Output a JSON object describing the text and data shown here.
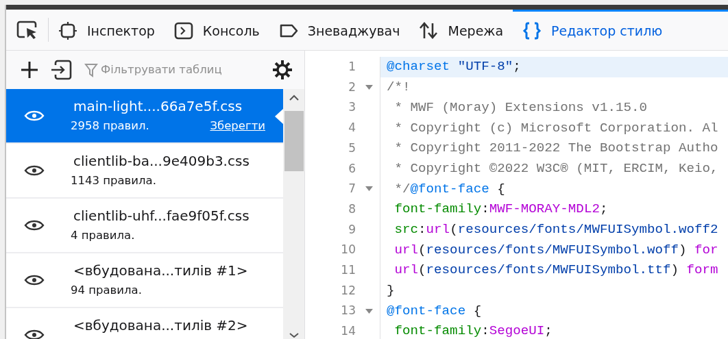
{
  "toolbar": {
    "tabs": [
      {
        "label": "Інспектор",
        "kind": "inspector",
        "selected": false
      },
      {
        "label": "Консоль",
        "kind": "console",
        "selected": false
      },
      {
        "label": "Зневаджувач",
        "kind": "debugger",
        "selected": false
      },
      {
        "label": "Мережа",
        "kind": "network",
        "selected": false
      },
      {
        "label": "Редактор стилю",
        "kind": "style-editor",
        "selected": true
      }
    ]
  },
  "sidebar": {
    "filter": {
      "placeholder": "Фільтрувати таблиц"
    },
    "items": [
      {
        "name": "main-light....66a7e5f.css",
        "rules": "2958 правил.",
        "save_link": "Зберегти",
        "selected": true
      },
      {
        "name": "clientlib-ba...9e409b3.css",
        "rules": "1143 правила.",
        "selected": false
      },
      {
        "name": "clientlib-uhf...fae9f05f.css",
        "rules": "4 правила.",
        "selected": false
      },
      {
        "name": "<вбудована...тилів #1>",
        "rules": "94 правила.",
        "selected": false
      },
      {
        "name": "<вбудована...тилів #2>",
        "selected": false
      }
    ]
  },
  "editor": {
    "lines": [
      {
        "number": "1",
        "foldable": false,
        "highlighted": true,
        "tokens": [
          {
            "kind": "atrule",
            "text": "@charset"
          },
          {
            "kind": "string",
            "text": " \"UTF-8\""
          },
          {
            "kind": "plain",
            "text": ";"
          }
        ]
      },
      {
        "number": "2",
        "foldable": true,
        "highlighted": false,
        "tokens": [
          {
            "kind": "comment",
            "text": "/*!"
          }
        ]
      },
      {
        "number": "3",
        "foldable": false,
        "highlighted": false,
        "tokens": [
          {
            "kind": "comment",
            "text": " * MWF (Moray) Extensions v1.15.0"
          }
        ]
      },
      {
        "number": "4",
        "foldable": false,
        "highlighted": false,
        "tokens": [
          {
            "kind": "comment",
            "text": " * Copyright (c) Microsoft Corporation. Al"
          }
        ]
      },
      {
        "number": "5",
        "foldable": false,
        "highlighted": false,
        "tokens": [
          {
            "kind": "comment",
            "text": " * Copyright 2011-2022 The Bootstrap Autho"
          }
        ]
      },
      {
        "number": "6",
        "foldable": false,
        "highlighted": false,
        "tokens": [
          {
            "kind": "comment",
            "text": " * Copyright ©2022 W3C® (MIT, ERCIM, Keio,"
          }
        ]
      },
      {
        "number": "7",
        "foldable": true,
        "highlighted": false,
        "tokens": [
          {
            "kind": "comment",
            "text": " */"
          },
          {
            "kind": "atrule",
            "text": "@font-face"
          },
          {
            "kind": "plain",
            "text": " {"
          }
        ]
      },
      {
        "number": "8",
        "foldable": false,
        "highlighted": false,
        "tokens": [
          {
            "kind": "property",
            "text": " font-family"
          },
          {
            "kind": "plain",
            "text": ":"
          },
          {
            "kind": "value",
            "text": "MWF-MORAY-MDL2"
          },
          {
            "kind": "plain",
            "text": ";"
          }
        ]
      },
      {
        "number": "9",
        "foldable": false,
        "highlighted": false,
        "tokens": [
          {
            "kind": "property",
            "text": " src"
          },
          {
            "kind": "plain",
            "text": ":"
          },
          {
            "kind": "value",
            "text": "url"
          },
          {
            "kind": "plain",
            "text": "("
          },
          {
            "kind": "string",
            "text": "resources/fonts/MWFUISymbol.woff2"
          }
        ]
      },
      {
        "number": "10",
        "foldable": false,
        "highlighted": false,
        "tokens": [
          {
            "kind": "value",
            "text": " url"
          },
          {
            "kind": "plain",
            "text": "("
          },
          {
            "kind": "string",
            "text": "resources/fonts/MWFUISymbol.woff"
          },
          {
            "kind": "plain",
            "text": ") "
          },
          {
            "kind": "value",
            "text": "for"
          }
        ]
      },
      {
        "number": "11",
        "foldable": false,
        "highlighted": false,
        "tokens": [
          {
            "kind": "value",
            "text": " url"
          },
          {
            "kind": "plain",
            "text": "("
          },
          {
            "kind": "string",
            "text": "resources/fonts/MWFUISymbol.ttf"
          },
          {
            "kind": "plain",
            "text": ") "
          },
          {
            "kind": "value",
            "text": "form"
          }
        ]
      },
      {
        "number": "12",
        "foldable": false,
        "highlighted": false,
        "tokens": [
          {
            "kind": "plain",
            "text": "}"
          }
        ]
      },
      {
        "number": "13",
        "foldable": true,
        "highlighted": false,
        "tokens": [
          {
            "kind": "atrule",
            "text": "@font-face"
          },
          {
            "kind": "plain",
            "text": " {"
          }
        ]
      },
      {
        "number": "14",
        "foldable": false,
        "highlighted": false,
        "tokens": [
          {
            "kind": "property",
            "text": " font-family"
          },
          {
            "kind": "plain",
            "text": ":"
          },
          {
            "kind": "value",
            "text": "SegoeUI"
          },
          {
            "kind": "plain",
            "text": ";"
          }
        ]
      }
    ]
  }
}
